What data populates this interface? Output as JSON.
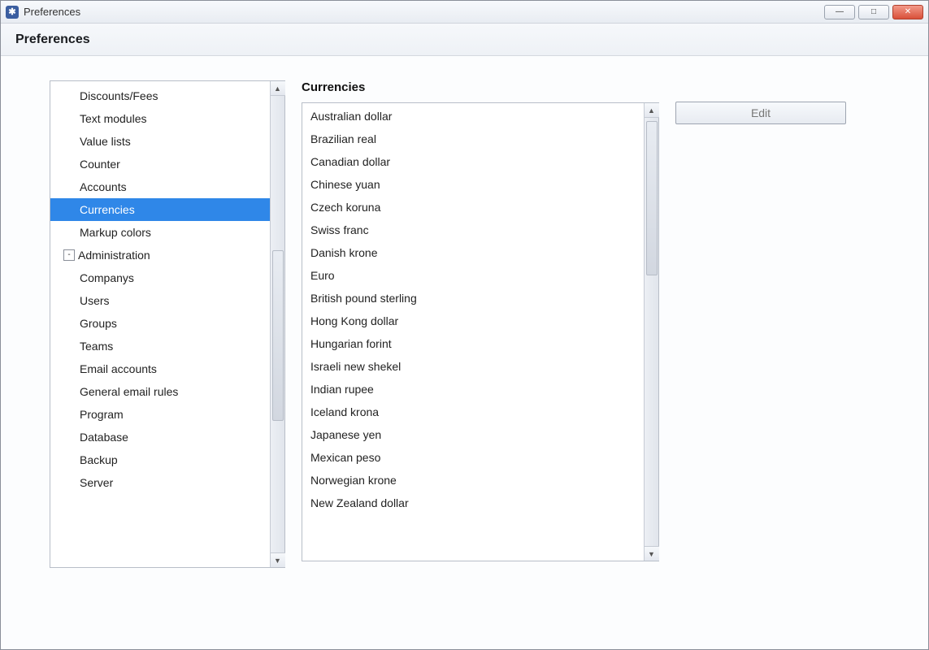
{
  "window": {
    "title": "Preferences",
    "app_icon_glyph": "✱"
  },
  "header": {
    "title": "Preferences"
  },
  "tree": {
    "items": [
      {
        "label": "Discounts/Fees",
        "level": 1,
        "selected": false
      },
      {
        "label": "Text modules",
        "level": 1,
        "selected": false
      },
      {
        "label": "Value lists",
        "level": 1,
        "selected": false
      },
      {
        "label": "Counter",
        "level": 1,
        "selected": false
      },
      {
        "label": "Accounts",
        "level": 1,
        "selected": false
      },
      {
        "label": "Currencies",
        "level": 1,
        "selected": true
      },
      {
        "label": "Markup colors",
        "level": 1,
        "selected": false
      },
      {
        "label": "Administration",
        "level": 0,
        "selected": false,
        "expander": "-"
      },
      {
        "label": "Companys",
        "level": 1,
        "selected": false
      },
      {
        "label": "Users",
        "level": 1,
        "selected": false
      },
      {
        "label": "Groups",
        "level": 1,
        "selected": false
      },
      {
        "label": "Teams",
        "level": 1,
        "selected": false
      },
      {
        "label": "Email accounts",
        "level": 1,
        "selected": false
      },
      {
        "label": "General email rules",
        "level": 1,
        "selected": false
      },
      {
        "label": "Program",
        "level": 1,
        "selected": false
      },
      {
        "label": "Database",
        "level": 1,
        "selected": false
      },
      {
        "label": "Backup",
        "level": 1,
        "selected": false
      },
      {
        "label": "Server",
        "level": 1,
        "selected": false
      }
    ]
  },
  "currencies": {
    "title": "Currencies",
    "items": [
      "Australian dollar",
      "Brazilian real",
      "Canadian dollar",
      "Chinese yuan",
      "Czech koruna",
      "Swiss franc",
      "Danish krone",
      "Euro",
      "British pound sterling",
      "Hong Kong dollar",
      "Hungarian forint",
      "Israeli new shekel",
      "Indian rupee",
      "Iceland krona",
      "Japanese yen",
      "Mexican peso",
      "Norwegian krone",
      "New Zealand dollar"
    ]
  },
  "buttons": {
    "edit": "Edit"
  },
  "window_controls": {
    "minimize": "—",
    "maximize": "□",
    "close": "✕"
  }
}
